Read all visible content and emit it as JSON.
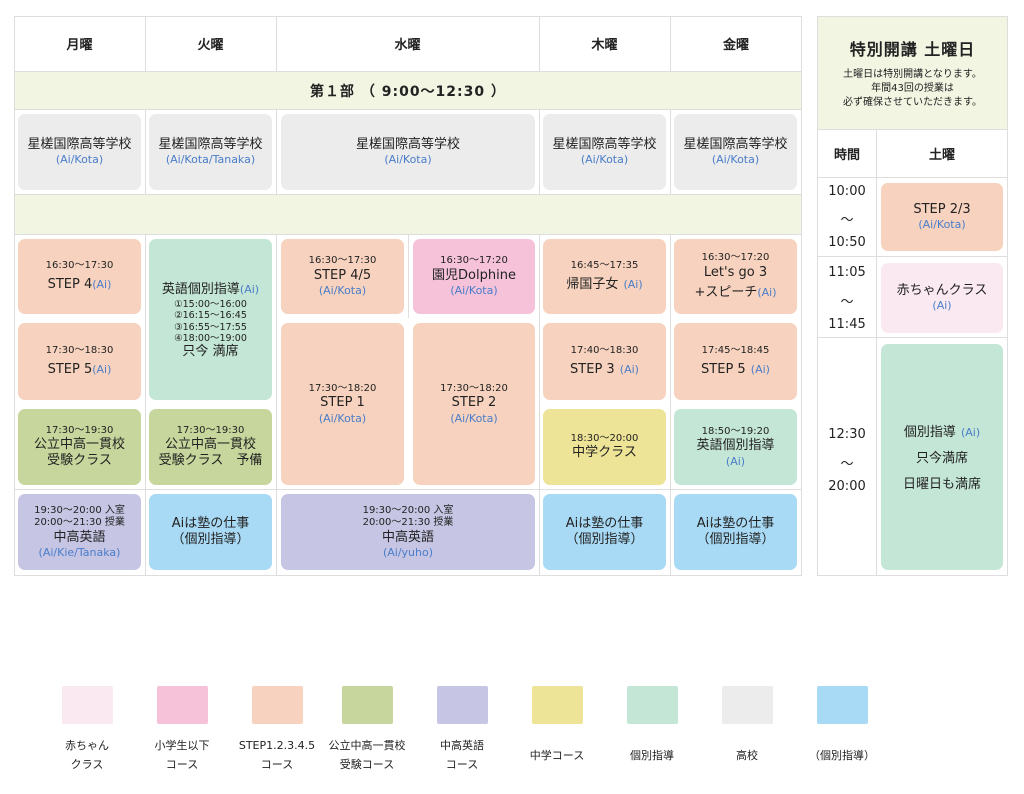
{
  "weekday_headers": [
    "月曜",
    "火曜",
    "水曜",
    "木曜",
    "金曜"
  ],
  "section1_label": "第１部 （ 9:00〜12:30 ）",
  "school_cells": [
    {
      "title": "星槎国際高等学校",
      "sub": "(Ai/Kota)"
    },
    {
      "title": "星槎国際高等学校",
      "sub": "(Ai/Kota/Tanaka)"
    },
    {
      "title": "星槎国際高等学校",
      "sub": "(Ai/Kota)"
    },
    {
      "title": "星槎国際高等学校",
      "sub": "(Ai/Kota)"
    },
    {
      "title": "星槎国際高等学校",
      "sub": "(Ai/Kota)"
    }
  ],
  "mon": {
    "step4": {
      "time": "16:30〜17:30",
      "title": "STEP 4",
      "tutor": "(Ai)"
    },
    "step5": {
      "time": "17:30〜18:30",
      "title": "STEP 5",
      "tutor": "(Ai)"
    },
    "pubjh": {
      "time": "17:30〜19:30",
      "line1": "公立中高一貫校",
      "line2": "受験クラス"
    },
    "english": {
      "line1": "19:30〜20:00 入室",
      "line2": "20:00〜21:30 授業",
      "title": "中高英語",
      "tutor": "(Ai/Kie/Tanaka)"
    }
  },
  "tue": {
    "indiv": {
      "title": "英語個別指導",
      "tutor": "(Ai)",
      "slot1": "①15:00〜16:00",
      "slot2": "②16:15〜16:45",
      "slot3": "③16:55〜17:55",
      "slot4": "④18:00〜19:00",
      "status": "只今 満席"
    },
    "pubjh": {
      "time": "17:30〜19:30",
      "line1": "公立中高一貫校",
      "line2": "受験クラス　予備"
    },
    "work": {
      "line1": "Aiは塾の仕事",
      "line2": "（個別指導）"
    }
  },
  "wed": {
    "step45": {
      "time": "16:30〜17:30",
      "title": "STEP 4/5",
      "tutor": "(Ai/Kota)"
    },
    "dolphine": {
      "time": "16:30〜17:20",
      "title": "園児Dolphine",
      "tutor": "(Ai/Kota)"
    },
    "step1": {
      "time": "17:30〜18:20",
      "title": "STEP 1",
      "tutor": "(Ai/Kota)"
    },
    "step2": {
      "time": "17:30〜18:20",
      "title": "STEP 2",
      "tutor": "(Ai/Kota)"
    },
    "english": {
      "line1": "19:30〜20:00 入室",
      "line2": "20:00〜21:30 授業",
      "title": "中高英語",
      "tutor": "(Ai/yuho)"
    }
  },
  "thu": {
    "kikoku": {
      "time": "16:45〜17:35",
      "title": "帰国子女",
      "tutor": "(Ai)"
    },
    "step3": {
      "time": "17:40〜18:30",
      "title": "STEP 3",
      "tutor": "(Ai)"
    },
    "jh": {
      "time": "18:30〜20:00",
      "title": "中学クラス"
    },
    "work": {
      "line1": "Aiは塾の仕事",
      "line2": "（個別指導）"
    }
  },
  "fri": {
    "letsgo": {
      "time": "16:30〜17:20",
      "title1": "Let's go 3",
      "title2": "+スピーチ",
      "tutor": "(Ai)"
    },
    "step5": {
      "time": "17:45〜18:45",
      "title": "STEP 5",
      "tutor": "(Ai)"
    },
    "indiv": {
      "time": "18:50〜19:20",
      "title": "英語個別指導",
      "tutor": "(Ai)"
    },
    "work": {
      "line1": "Aiは塾の仕事",
      "line2": "（個別指導）"
    }
  },
  "saturday": {
    "title": "特別開講 土曜日",
    "desc1": "土曜日は特別開講となります。",
    "desc2": "年間43回の授業は",
    "desc3": "必ず確保させていただきます。",
    "col_time": "時間",
    "col_day": "土曜",
    "row1": {
      "t1": "10:00",
      "t2": "〜",
      "t3": "10:50",
      "title": "STEP 2/3",
      "tutor": "(Ai/Kota)"
    },
    "row2": {
      "t1": "11:05",
      "t2": "〜",
      "t3": "11:45",
      "title": "赤ちゃんクラス",
      "tutor": "(Ai)"
    },
    "row3": {
      "t1": "12:30",
      "t2": "〜",
      "t3": "20:00",
      "title": "個別指導",
      "tutor": "(Ai)",
      "line2": "只今満席",
      "line3": "日曜日も満席"
    }
  },
  "legend": [
    {
      "line1": "赤ちゃん",
      "line2": "クラス",
      "color": "#fbe9f1"
    },
    {
      "line1": "小学生以下",
      "line2": "コース",
      "color": "#f5c2da"
    },
    {
      "line1": "STEP1.2.3.4.5",
      "line2": "コース",
      "color": "#f7d3bf"
    },
    {
      "line1": "公立中高一貫校",
      "line2": "受験コース",
      "color": "#c7d69c"
    },
    {
      "line1": "中高英語",
      "line2": "コース",
      "color": "#c6c5e4"
    },
    {
      "line1": "中学コース",
      "line2": "",
      "color": "#ede497"
    },
    {
      "line1": "個別指導",
      "line2": "",
      "color": "#c4e6d6"
    },
    {
      "line1": "高校",
      "line2": "",
      "color": "#ececec"
    },
    {
      "line1": "（個別指導）",
      "line2": "",
      "color": "#a9daf5"
    }
  ]
}
